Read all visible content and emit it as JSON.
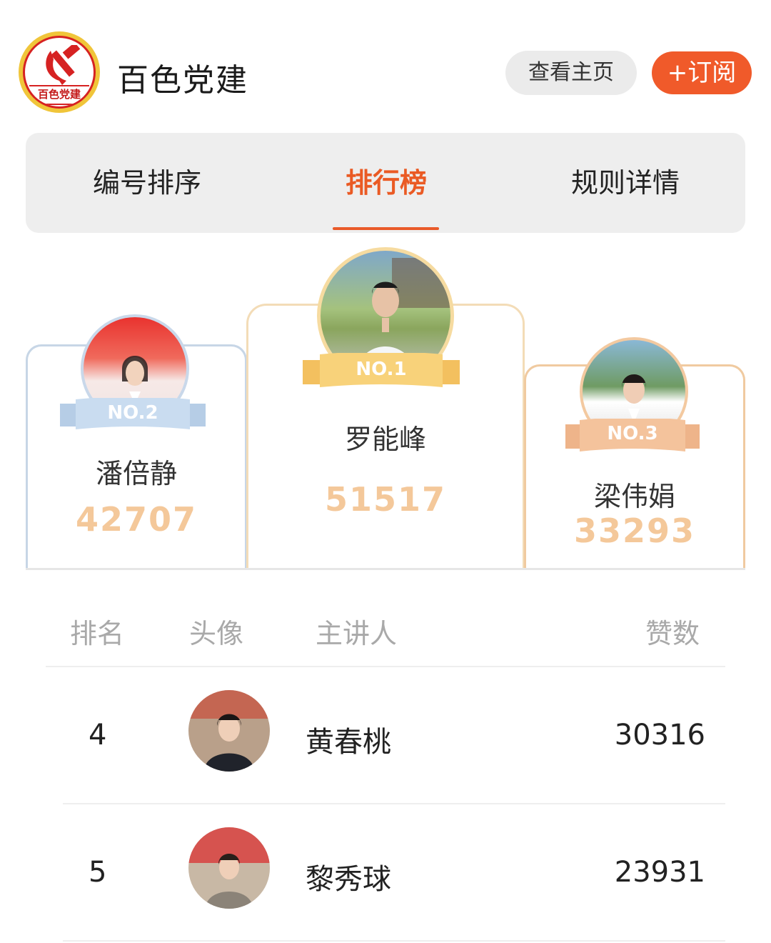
{
  "header": {
    "logo_text": "百色党建",
    "account_name": "百色党建",
    "view_home_label": "查看主页",
    "subscribe_label": "+订阅",
    "accent_color": "#f05a2a"
  },
  "tabs": [
    {
      "label": "编号排序",
      "active": false
    },
    {
      "label": "排行榜",
      "active": true
    },
    {
      "label": "规则详情",
      "active": false
    }
  ],
  "podium": {
    "first": {
      "badge": "NO.1",
      "name": "罗能峰",
      "likes": "51517"
    },
    "second": {
      "badge": "NO.2",
      "name": "潘倍静",
      "likes": "42707"
    },
    "third": {
      "badge": "NO.3",
      "name": "梁伟娟",
      "likes": "33293"
    }
  },
  "list": {
    "headers": {
      "rank": "排名",
      "avatar": "头像",
      "speaker": "主讲人",
      "likes": "赞数"
    },
    "rows": [
      {
        "rank": "4",
        "name": "黄春桃",
        "likes": "30316"
      },
      {
        "rank": "5",
        "name": "黎秀球",
        "likes": "23931"
      }
    ]
  }
}
